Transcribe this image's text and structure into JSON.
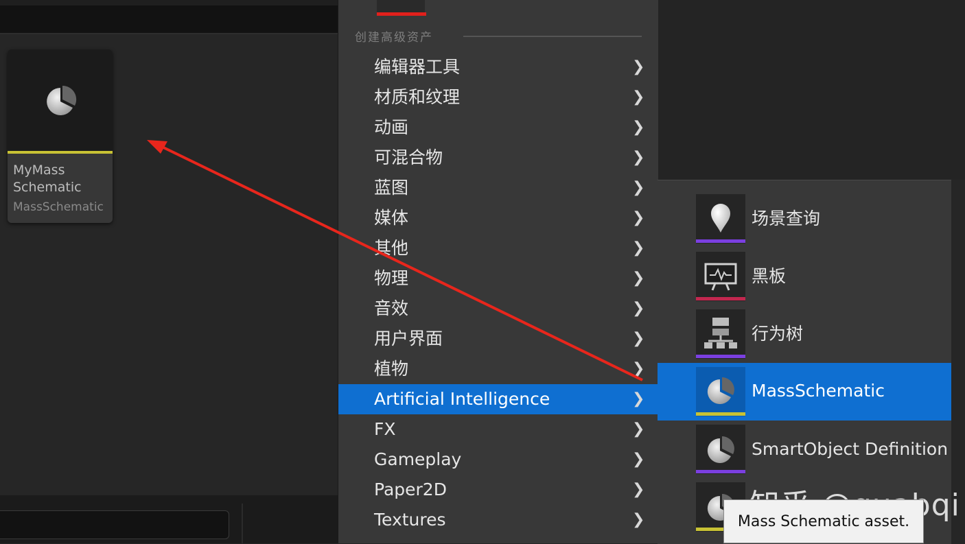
{
  "content_browser": {
    "asset": {
      "name": "MyMass Schematic",
      "type_label": "MassSchematic",
      "icon": "pie-chart-icon",
      "color_bar": "#c8c234"
    }
  },
  "menu": {
    "section_header": "创建高级资产",
    "items": [
      {
        "label": "编辑器工具"
      },
      {
        "label": "材质和纹理"
      },
      {
        "label": "动画"
      },
      {
        "label": "可混合物"
      },
      {
        "label": "蓝图"
      },
      {
        "label": "媒体"
      },
      {
        "label": "其他"
      },
      {
        "label": "物理"
      },
      {
        "label": "音效"
      },
      {
        "label": "用户界面"
      },
      {
        "label": "植物"
      },
      {
        "label": "Artificial Intelligence",
        "active": true
      },
      {
        "label": "FX"
      },
      {
        "label": "Gameplay"
      },
      {
        "label": "Paper2D"
      },
      {
        "label": "Textures"
      }
    ],
    "accent_color": "#0f6fd1"
  },
  "submenu": {
    "items": [
      {
        "label": "场景查询",
        "icon": "location-pin-icon",
        "bar_color": "#7b3fe0"
      },
      {
        "label": "黑板",
        "icon": "blackboard-easel-icon",
        "bar_color": "#c2274f"
      },
      {
        "label": "行为树",
        "icon": "tree-hierarchy-icon",
        "bar_color": "#7b3fe0"
      },
      {
        "label": "MassSchematic",
        "icon": "pie-chart-icon",
        "bar_color": "#c8c234",
        "active": true
      },
      {
        "label": "SmartObject Definition",
        "icon": "pie-chart-icon",
        "bar_color": "#7b3fe0"
      },
      {
        "label": "",
        "icon": "pie-chart-icon",
        "bar_color": "#c8c234"
      }
    ]
  },
  "tooltip": {
    "text": "Mass Schematic asset."
  },
  "watermark": {
    "text": "知乎 @quabqi"
  },
  "annotation": {
    "arrow_color": "#e8261c"
  }
}
